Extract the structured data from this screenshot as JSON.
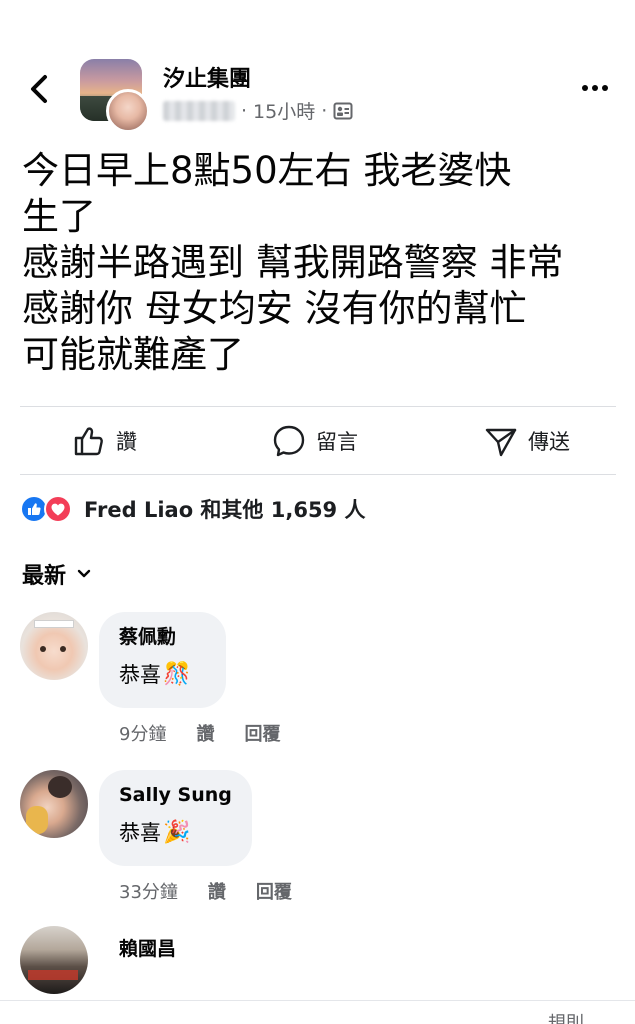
{
  "header": {
    "group_name": "汐止集團",
    "time": "15小時",
    "separator": "·",
    "privacy_icon": "group-privacy-icon",
    "back_icon": "back-arrow-icon",
    "more_icon": "more-dots-icon"
  },
  "post": {
    "text": "今日早上8點50左右 我老婆快\n生了\n感謝半路遇到 幫我開路警察 非常\n感謝你 母女均安 沒有你的幫忙\n可能就難產了"
  },
  "actions": {
    "like_label": "讚",
    "comment_label": "留言",
    "share_label": "傳送"
  },
  "reactions": {
    "summary": "Fred Liao 和其他 1,659 人",
    "like_color": "#1877f2",
    "love_color": "#f33e58"
  },
  "sort": {
    "label": "最新"
  },
  "comments": [
    {
      "name": "蔡佩勳",
      "text": "恭喜",
      "emoji": "🎊",
      "time": "9分鐘",
      "like": "讚",
      "reply": "回覆"
    },
    {
      "name": "Sally Sung",
      "text": "恭喜",
      "emoji": "🎉",
      "time": "33分鐘",
      "like": "讚",
      "reply": "回覆"
    },
    {
      "name": "賴國昌"
    }
  ],
  "bottom": {
    "text": "規則"
  }
}
